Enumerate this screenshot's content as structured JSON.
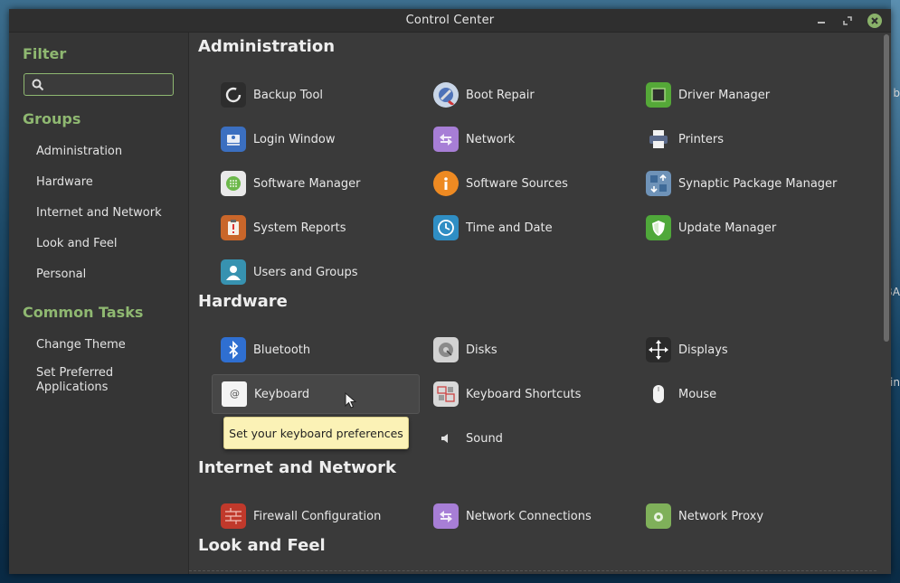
{
  "window": {
    "title": "Control Center"
  },
  "desktop": {
    "fragments": [
      "b",
      "BA",
      "in"
    ]
  },
  "sidebar": {
    "filter_heading": "Filter",
    "search_value": "",
    "groups_heading": "Groups",
    "groups": [
      {
        "label": "Administration"
      },
      {
        "label": "Hardware"
      },
      {
        "label": "Internet and Network"
      },
      {
        "label": "Look and Feel"
      },
      {
        "label": "Personal"
      }
    ],
    "tasks_heading": "Common Tasks",
    "tasks": [
      {
        "label": "Change Theme"
      },
      {
        "label": "Set Preferred\nApplications"
      }
    ]
  },
  "sections": {
    "administration": {
      "title": "Administration",
      "items": [
        {
          "label": "Backup Tool",
          "icon": "backup-icon"
        },
        {
          "label": "Boot Repair",
          "icon": "boot-repair-icon"
        },
        {
          "label": "Driver Manager",
          "icon": "chip-icon"
        },
        {
          "label": "Login Window",
          "icon": "login-window-icon"
        },
        {
          "label": "Network",
          "icon": "network-icon"
        },
        {
          "label": "Printers",
          "icon": "printer-icon"
        },
        {
          "label": "Software Manager",
          "icon": "software-manager-icon"
        },
        {
          "label": "Software Sources",
          "icon": "info-icon"
        },
        {
          "label": "Synaptic Package Manager",
          "icon": "synaptic-icon"
        },
        {
          "label": "System Reports",
          "icon": "clipboard-icon"
        },
        {
          "label": "Time and Date",
          "icon": "clock-icon"
        },
        {
          "label": "Update Manager",
          "icon": "shield-icon"
        },
        {
          "label": "Users and Groups",
          "icon": "user-icon"
        }
      ]
    },
    "hardware": {
      "title": "Hardware",
      "items": [
        {
          "label": "Bluetooth",
          "icon": "bluetooth-icon"
        },
        {
          "label": "Disks",
          "icon": "disk-icon"
        },
        {
          "label": "Displays",
          "icon": "displays-icon"
        },
        {
          "label": "Keyboard",
          "icon": "keyboard-icon"
        },
        {
          "label": "Keyboard Shortcuts",
          "icon": "keyboard-shortcuts-icon"
        },
        {
          "label": "Mouse",
          "icon": "mouse-icon"
        },
        {
          "label": "Sound",
          "icon": "speaker-icon"
        }
      ]
    },
    "internet": {
      "title": "Internet and Network",
      "items": [
        {
          "label": "Firewall Configuration",
          "icon": "firewall-icon"
        },
        {
          "label": "Network Connections",
          "icon": "network-connections-icon"
        },
        {
          "label": "Network Proxy",
          "icon": "proxy-icon"
        }
      ]
    },
    "look": {
      "title": "Look and Feel"
    }
  },
  "tooltip": {
    "text": "Set your keyboard preferences"
  },
  "colors": {
    "accent": "#8fb871",
    "window_bg": "#3a3a3a",
    "sidebar_bg": "#353535",
    "tooltip_bg": "#fbf2b6"
  }
}
